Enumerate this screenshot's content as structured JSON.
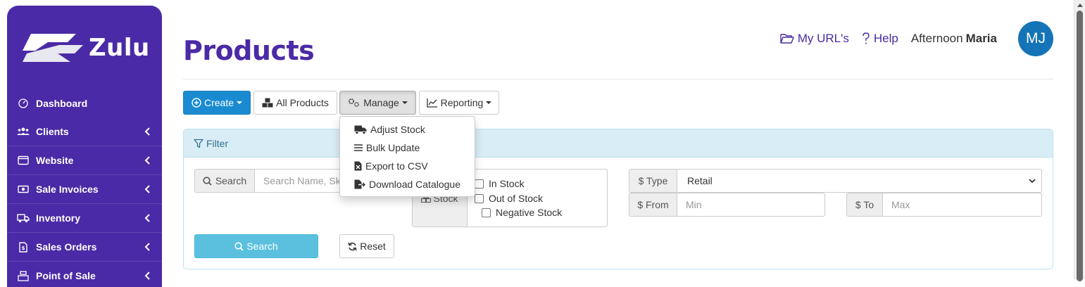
{
  "brand": {
    "name": "Zulu"
  },
  "sidebar": {
    "items": [
      {
        "label": "Dashboard",
        "icon": "dashboard-icon",
        "has_submenu": false
      },
      {
        "label": "Clients",
        "icon": "users-icon",
        "has_submenu": true
      },
      {
        "label": "Website",
        "icon": "window-icon",
        "has_submenu": true
      },
      {
        "label": "Sale Invoices",
        "icon": "money-icon",
        "has_submenu": true
      },
      {
        "label": "Inventory",
        "icon": "truck-icon",
        "has_submenu": true
      },
      {
        "label": "Sales Orders",
        "icon": "file-dollar-icon",
        "has_submenu": true
      },
      {
        "label": "Point of Sale",
        "icon": "cash-register-icon",
        "has_submenu": true
      }
    ]
  },
  "topbar": {
    "my_urls": "My URL's",
    "help": "Help",
    "greeting": "Afternoon",
    "user_name": "Maria",
    "avatar_initials": "MJ"
  },
  "page": {
    "title": "Products"
  },
  "toolbar": {
    "create": "Create",
    "all_products": "All Products",
    "manage": "Manage",
    "reporting": "Reporting"
  },
  "manage_menu": {
    "items": [
      {
        "label": "Adjust Stock",
        "icon": "truck-icon"
      },
      {
        "label": "Bulk Update",
        "icon": "list-icon"
      },
      {
        "label": "Export to CSV",
        "icon": "file-excel-icon"
      },
      {
        "label": "Download Catalogue",
        "icon": "file-export-icon"
      }
    ]
  },
  "filter": {
    "title": "Filter",
    "search_label": "Search",
    "search_placeholder": "Search Name, Sku",
    "stock_label": "Stock",
    "stock_options": [
      "In Stock",
      "Out of Stock",
      "Negative Stock"
    ],
    "type_label": "$ Type",
    "type_value": "Retail",
    "from_label": "$ From",
    "from_placeholder": "Min",
    "to_label": "$ To",
    "to_placeholder": "Max",
    "search_button": "Search",
    "reset_button": "Reset"
  },
  "colors": {
    "brand_purple": "#4a2aa6",
    "primary_blue": "#1a8bd0",
    "info_cyan": "#5bc0de",
    "filter_header_bg": "#d9edf6",
    "avatar_bg": "#1474b7"
  }
}
